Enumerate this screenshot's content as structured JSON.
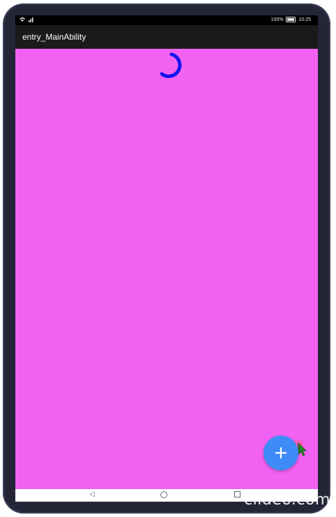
{
  "statusbar": {
    "left_icons": [
      "wifi-icon",
      "signal-icon"
    ],
    "battery_text": "100%",
    "time": "10:25"
  },
  "app": {
    "title": "entry_MainAbility"
  },
  "content": {
    "background": "#f262f2",
    "spinner_color": "#1515ee"
  },
  "fab": {
    "label": "+",
    "color": "#3f8cf8"
  },
  "watermark": {
    "text": "clideo.com"
  }
}
